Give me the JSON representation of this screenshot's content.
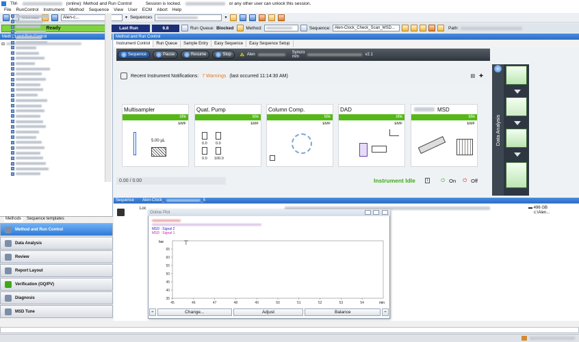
{
  "titlebar": {
    "prefix": "TM-",
    "online": "(online): Method and Run Control",
    "lock_pre": "Session is locked.",
    "lock_post": "or any other user can unlock this session."
  },
  "menu": [
    "File",
    "RunControl",
    "Instrument",
    "Method",
    "Sequence",
    "View",
    "User",
    "ECM",
    "Abort",
    "Help"
  ],
  "toolbar": {
    "methods_label": "Methods",
    "method_combo": "Alen-c...",
    "sequences_label": "Sequences"
  },
  "status": {
    "ready": "Ready",
    "last_run": "Last Run",
    "run_number": "6.8",
    "run_queue_label": "Run Queue:",
    "run_queue_value": "Blocked",
    "method_label": "Method:",
    "sequence_label": "Sequence:",
    "sequence_value": "Alen-Clock_Check_Scan_MSD...",
    "path_label": "Path:"
  },
  "left": {
    "header": "Method and Run Control",
    "tabs": [
      "Methods",
      "Sequence templates"
    ],
    "nav": [
      "Method and Run Control",
      "Data Analysis",
      "Review",
      "Report Layout",
      "Verification (OQ/PV)",
      "Diagnosis",
      "MSD Tune"
    ]
  },
  "main": {
    "header": "Method and Run Control",
    "tabs": [
      "Instrument Control",
      "Run Queue",
      "Sample Entry",
      "Easy Sequence",
      "Easy Sequence Setup"
    ],
    "controls": {
      "sequence": "Sequence",
      "pause": "Pause",
      "resume": "Resume",
      "stop": "Stop",
      "alen": "Alen",
      "syncro": "Syncro",
      "v": "v2.1",
      "mm": "mm"
    },
    "notifications": {
      "label": "Recent Instrument Notifications:",
      "warnings": "7 Warnings",
      "last": "(last occurred 11:14:30 AM)"
    },
    "modules": [
      {
        "title": "Multisampler",
        "status": "Idle",
        "emf": "EMF",
        "value": "5.00 µL"
      },
      {
        "title": "Quat. Pump",
        "status": "Idle",
        "emf": "EMF",
        "vals": [
          "0.0",
          "0.0",
          "0.0",
          "100.0"
        ]
      },
      {
        "title": "Column Comp.",
        "status": "Idle",
        "emf": "EMF"
      },
      {
        "title": "DAD",
        "status": "Idle",
        "emf": "EMF"
      },
      {
        "title": "MSD",
        "status": "Idle",
        "emf": "EMF"
      }
    ],
    "progress": "0.00 / 0.00",
    "instrument_status": "Instrument Idle",
    "on_label": "On",
    "off_label": "Off",
    "data_analysis": "Data Analysis"
  },
  "sequence": {
    "header": "Sequence",
    "header_value": "Alen-Clock_",
    "header_suffix": "_5",
    "loc": "Loc",
    "disk": "496 GB",
    "path": "c:\\Alen..."
  },
  "online_plot": {
    "title": "Online Plot",
    "legend": [
      {
        "text": "MSD : Signal 2",
        "color": "#2222cc"
      },
      {
        "text": "MSD : Signal 1",
        "color": "#cc22aa"
      }
    ],
    "buttons": [
      "Change...",
      "Adjust",
      "Balance"
    ]
  },
  "chart_data": {
    "type": "line",
    "title": "",
    "xlabel": "min",
    "ylabel": "bar",
    "xlim": [
      45,
      55
    ],
    "ylim": [
      35,
      70
    ],
    "xticks": [
      45,
      46,
      47,
      48,
      49,
      50,
      51,
      52,
      53,
      54
    ],
    "yticks": [
      35,
      40,
      45,
      50,
      55,
      60,
      65
    ],
    "grid": true,
    "series": []
  },
  "colors": {
    "ready": "#7fd340",
    "accent": "#2e7ad8",
    "idle": "#55b818",
    "warn": "#e07a1e",
    "navy": "#1c2f7a"
  }
}
